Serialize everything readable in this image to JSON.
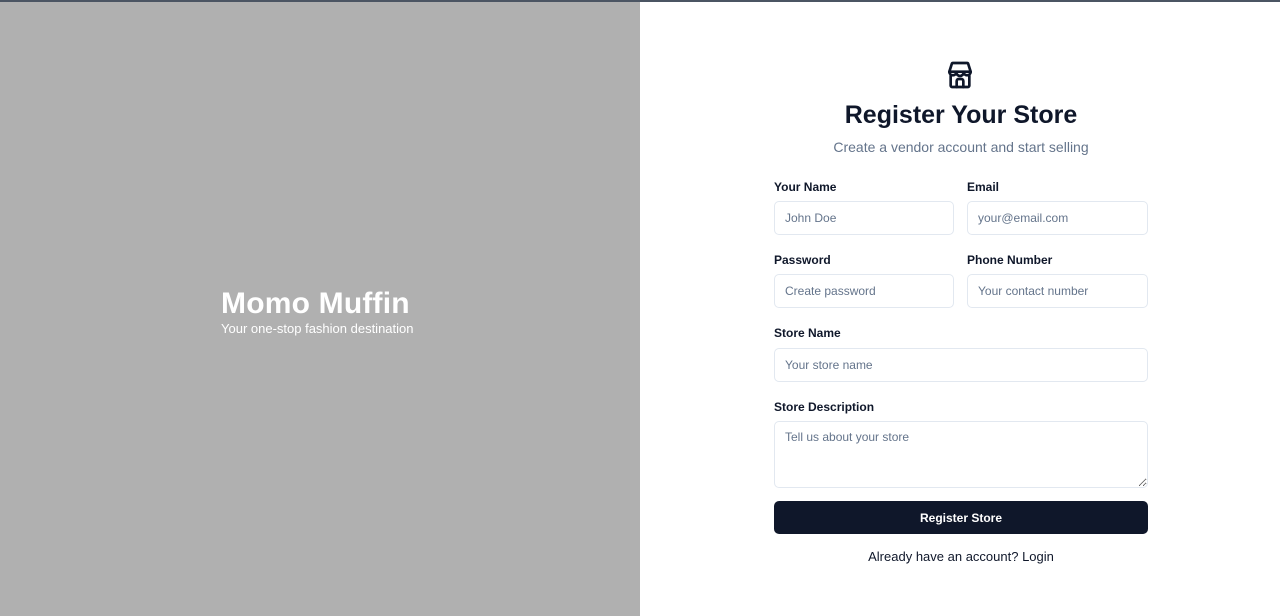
{
  "brand": {
    "title": "Momo Muffin",
    "tagline": "Your one-stop fashion destination"
  },
  "form": {
    "icon": "store-icon",
    "title": "Register Your Store",
    "subtitle": "Create a vendor account and start selling",
    "fields": {
      "name": {
        "label": "Your Name",
        "placeholder": "John Doe"
      },
      "email": {
        "label": "Email",
        "placeholder": "your@email.com"
      },
      "password": {
        "label": "Password",
        "placeholder": "Create password"
      },
      "phone": {
        "label": "Phone Number",
        "placeholder": "Your contact number"
      },
      "store_name": {
        "label": "Store Name",
        "placeholder": "Your store name"
      },
      "store_description": {
        "label": "Store Description",
        "placeholder": "Tell us about your store"
      }
    },
    "submit_label": "Register Store",
    "login_prompt": "Already have an account?",
    "login_link": "Login"
  },
  "colors": {
    "left_panel_bg": "#b0b0b0",
    "primary": "#0f172a",
    "muted_text": "#64748b",
    "input_border": "#e2e8f0"
  }
}
